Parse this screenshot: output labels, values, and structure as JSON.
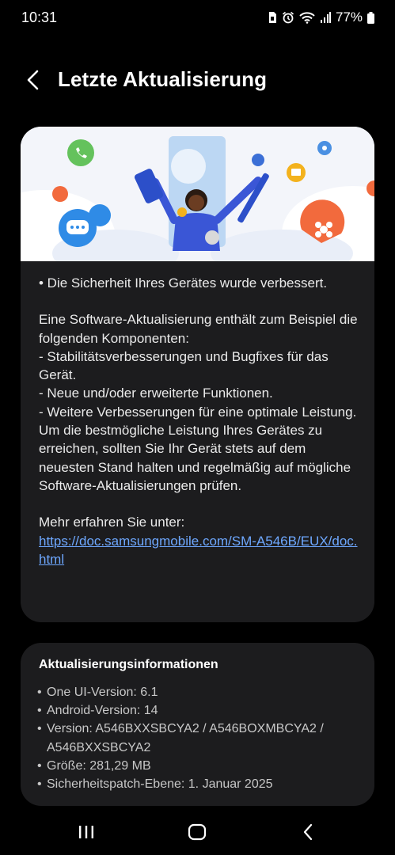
{
  "status_bar": {
    "time": "10:31",
    "battery_percent": "77%",
    "icons": [
      "sim-icon",
      "alarm-icon",
      "wifi-icon",
      "signal-icon",
      "battery-icon"
    ]
  },
  "header": {
    "title": "Letzte Aktualisierung",
    "back_icon": "back-arrow-icon"
  },
  "release_notes": {
    "line1": "• Die Sicherheit Ihres Gerätes wurde verbessert.",
    "para1": "Eine Software-Aktualisierung enthält zum Beispiel die folgenden Komponenten:",
    "item1": " - Stabilitätsverbesserungen und Bugfixes für das Gerät.",
    "item2": " - Neue und/oder erweiterte Funktionen.",
    "item3": " - Weitere Verbesserungen für eine optimale Leistung.",
    "para2": "Um die bestmögliche Leistung Ihres Gerätes zu erreichen, sollten Sie Ihr Gerät stets auf dem neuesten Stand halten und regelmäßig auf mögliche Software-Aktualisierungen prüfen.",
    "more_label": "Mehr erfahren Sie unter:",
    "link": "https://doc.samsungmobile.com/SM-A546B/EUX/doc.html"
  },
  "update_info": {
    "title": "Aktualisierungsinformationen",
    "one_ui": "One UI-Version: 6.1",
    "android": "Android-Version: 14",
    "version": "Version: A546BXXSBCYA2 / A546BOXMBCYA2 / A546BXXSBCYA2",
    "size": "Größe: 281,29 MB",
    "patch": "Sicherheitspatch-Ebene: 1. Januar 2025"
  },
  "nav_bar": {
    "icons": [
      "recents-icon",
      "home-icon",
      "back-icon"
    ]
  },
  "colors": {
    "background": "#000000",
    "card": "#1c1c1e",
    "link": "#6ea8ff",
    "text": "#eaeaea"
  }
}
